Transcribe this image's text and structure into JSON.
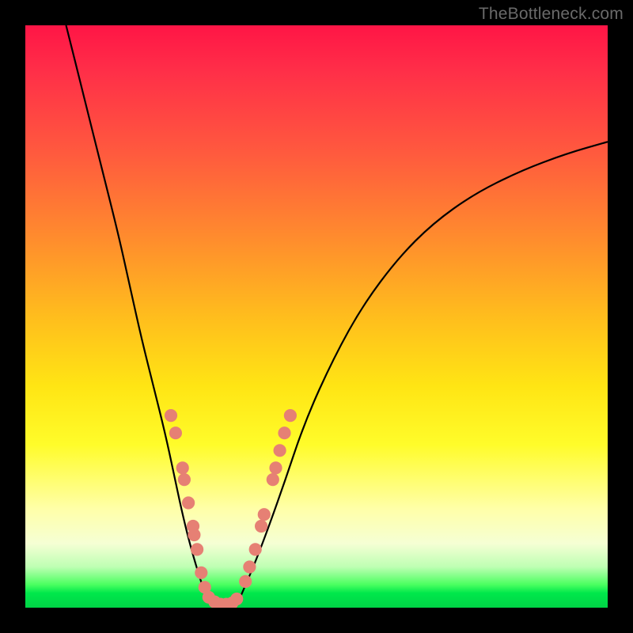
{
  "watermark": "TheBottleneck.com",
  "chart_data": {
    "type": "line",
    "title": "",
    "xlabel": "",
    "ylabel": "",
    "xlim": [
      0,
      100
    ],
    "ylim": [
      0,
      100
    ],
    "grid": false,
    "legend": false,
    "background_gradient": {
      "direction": "vertical",
      "stops": [
        {
          "pos": 0,
          "color": "#ff1546"
        },
        {
          "pos": 50,
          "color": "#ffbd1d"
        },
        {
          "pos": 83,
          "color": "#ffffa8"
        },
        {
          "pos": 96,
          "color": "#4cff61"
        },
        {
          "pos": 100,
          "color": "#00d346"
        }
      ]
    },
    "series": [
      {
        "name": "left-branch",
        "x": [
          7,
          10,
          13,
          16,
          18,
          20,
          22,
          24,
          25.5,
          27,
          28.5,
          30,
          31
        ],
        "y": [
          100,
          88,
          76,
          64,
          55,
          46,
          38,
          30,
          23,
          16,
          10,
          5,
          2
        ]
      },
      {
        "name": "valley-floor",
        "x": [
          31,
          32,
          33,
          34,
          35,
          36,
          37
        ],
        "y": [
          2,
          1,
          0.5,
          0.5,
          0.5,
          1,
          2
        ]
      },
      {
        "name": "right-branch",
        "x": [
          37,
          40,
          44,
          48,
          53,
          58,
          64,
          70,
          77,
          85,
          93,
          100
        ],
        "y": [
          2,
          9,
          20,
          32,
          43,
          52,
          60,
          66,
          71,
          75,
          78,
          80
        ]
      }
    ],
    "markers": {
      "name": "highlighted-points",
      "color": "#e68074",
      "radius_frac": 0.011,
      "points": [
        {
          "x": 25.0,
          "y": 33
        },
        {
          "x": 25.8,
          "y": 30
        },
        {
          "x": 27.0,
          "y": 24
        },
        {
          "x": 27.3,
          "y": 22
        },
        {
          "x": 28.0,
          "y": 18
        },
        {
          "x": 28.8,
          "y": 14
        },
        {
          "x": 29.0,
          "y": 12.5
        },
        {
          "x": 29.5,
          "y": 10
        },
        {
          "x": 30.2,
          "y": 6
        },
        {
          "x": 30.8,
          "y": 3.5
        },
        {
          "x": 31.5,
          "y": 1.8
        },
        {
          "x": 32.5,
          "y": 1.0
        },
        {
          "x": 33.5,
          "y": 0.6
        },
        {
          "x": 34.5,
          "y": 0.6
        },
        {
          "x": 35.5,
          "y": 0.8
        },
        {
          "x": 36.3,
          "y": 1.5
        },
        {
          "x": 37.8,
          "y": 4.5
        },
        {
          "x": 38.5,
          "y": 7
        },
        {
          "x": 39.5,
          "y": 10
        },
        {
          "x": 40.5,
          "y": 14
        },
        {
          "x": 41.0,
          "y": 16
        },
        {
          "x": 42.5,
          "y": 22
        },
        {
          "x": 43.0,
          "y": 24
        },
        {
          "x": 43.7,
          "y": 27
        },
        {
          "x": 44.5,
          "y": 30
        },
        {
          "x": 45.5,
          "y": 33
        }
      ]
    }
  }
}
